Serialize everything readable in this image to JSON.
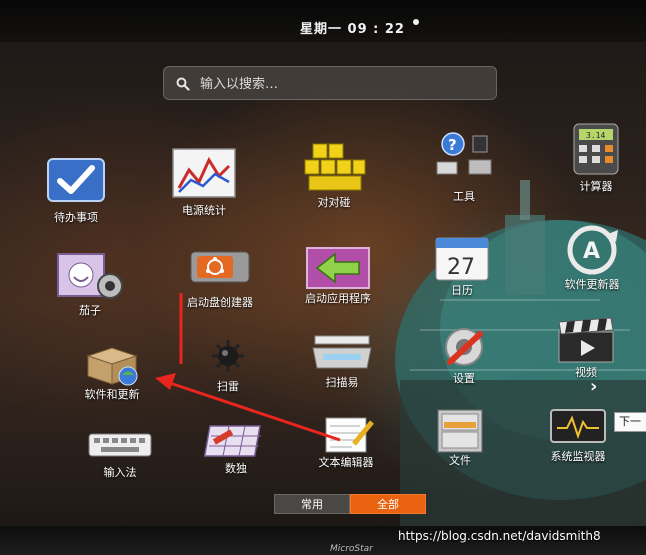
{
  "topbar": {
    "clock": "星期一 09 : 22"
  },
  "search": {
    "placeholder": "输入以搜索…"
  },
  "apps": {
    "todo": "待办事项",
    "power_stats": "电源统计",
    "tetravex": "对对碰",
    "tools": "工具",
    "calculator": "计算器",
    "cheese": "茄子",
    "usb_creator": "启动盘创建器",
    "startup_apps": "启动应用程序",
    "calendar": "日历",
    "calendar_day": "27",
    "calculator_display": "3.14",
    "software_updater": "软件更新器",
    "software_updates": "软件和更新",
    "mines": "扫雷",
    "scanner": "扫描易",
    "settings": "设置",
    "videos": "视频",
    "input_method": "输入法",
    "sudoku": "数独",
    "text_editor": "文本编辑器",
    "files": "文件",
    "system_monitor": "系统监视器"
  },
  "tabs": {
    "common": "常用",
    "all": "全部"
  },
  "next_tooltip": "下一",
  "watermark": "https://blog.csdn.net/davidsmith8",
  "bezel_logo": "MicroStar",
  "colors": {
    "accent": "#e9620f",
    "arrow": "#e8261e"
  }
}
